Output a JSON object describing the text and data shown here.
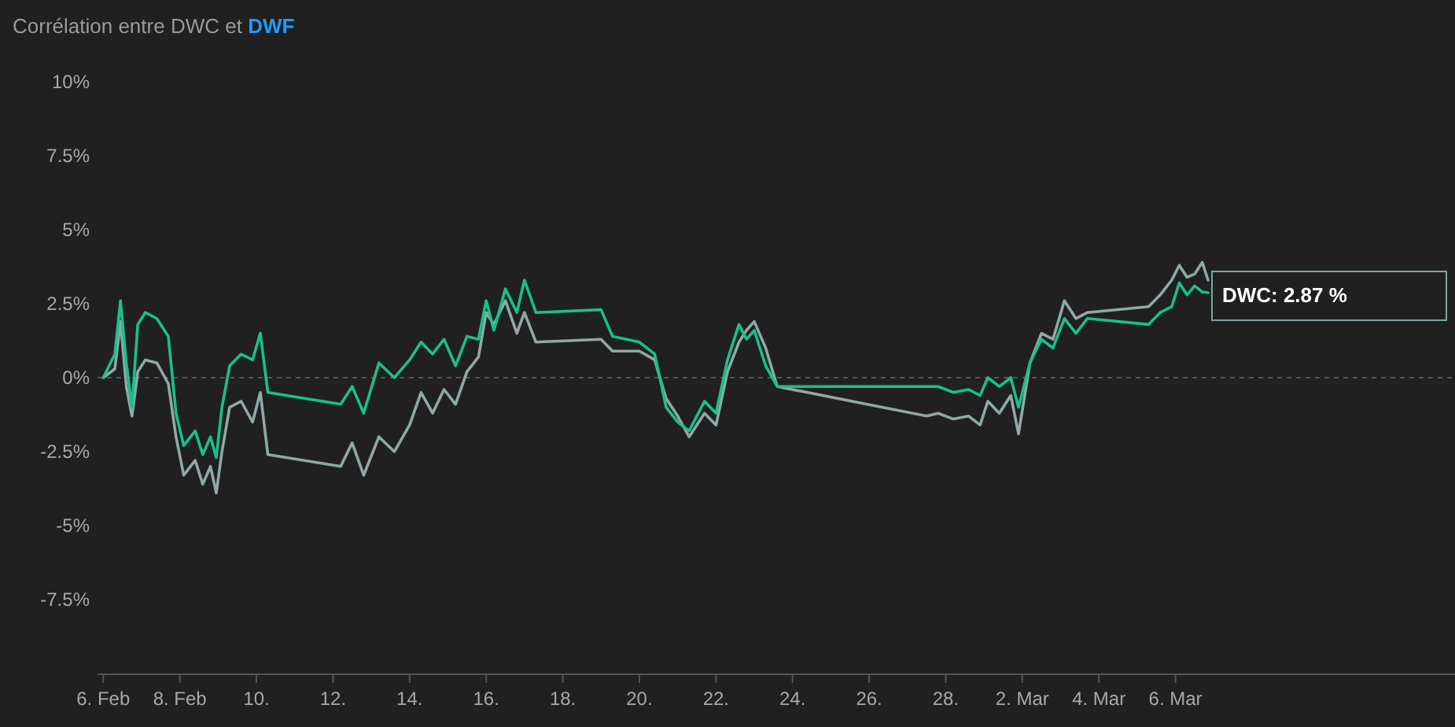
{
  "title": {
    "prefix": "Corrélation entre",
    "joiner": "et"
  },
  "tooltip": {
    "text": "DWC: 2.87 %"
  },
  "chart_data": {
    "type": "line",
    "xlim": [
      5.85,
      41.3
    ],
    "ylim": [
      -10,
      10
    ],
    "yticks": [
      {
        "value": 10,
        "label": "10%"
      },
      {
        "value": 7.5,
        "label": "7.5%"
      },
      {
        "value": 5,
        "label": "5%"
      },
      {
        "value": 2.5,
        "label": "2.5%"
      },
      {
        "value": 0,
        "label": "0%"
      },
      {
        "value": -2.5,
        "label": "-2.5%"
      },
      {
        "value": -5,
        "label": "-5%"
      },
      {
        "value": -7.5,
        "label": "-7.5%"
      }
    ],
    "xticks": [
      {
        "value": 6,
        "label": "6. Feb"
      },
      {
        "value": 8,
        "label": "8. Feb"
      },
      {
        "value": 10,
        "label": "10."
      },
      {
        "value": 12,
        "label": "12."
      },
      {
        "value": 14,
        "label": "14."
      },
      {
        "value": 16,
        "label": "16."
      },
      {
        "value": 18,
        "label": "18."
      },
      {
        "value": 20,
        "label": "20."
      },
      {
        "value": 22,
        "label": "22."
      },
      {
        "value": 24,
        "label": "24."
      },
      {
        "value": 26,
        "label": "26."
      },
      {
        "value": 28,
        "label": "28."
      },
      {
        "value": 30,
        "label": "2. Mar"
      },
      {
        "value": 32,
        "label": "4. Mar"
      },
      {
        "value": 34,
        "label": "6. Mar"
      }
    ],
    "x": [
      6,
      6.3,
      6.45,
      6.6,
      6.75,
      6.9,
      7.1,
      7.4,
      7.7,
      7.9,
      8.1,
      8.4,
      8.6,
      8.8,
      8.95,
      9.1,
      9.3,
      9.6,
      9.9,
      10.1,
      10.3,
      12.2,
      12.5,
      12.8,
      13.2,
      13.6,
      14.0,
      14.3,
      14.6,
      14.9,
      15.2,
      15.5,
      15.8,
      16.0,
      16.2,
      16.5,
      16.8,
      17.0,
      17.3,
      19.0,
      19.3,
      20.0,
      20.4,
      20.7,
      21.0,
      21.3,
      21.7,
      22.0,
      22.3,
      22.6,
      22.8,
      23.0,
      23.3,
      23.6,
      27.5,
      27.8,
      28.2,
      28.6,
      28.9,
      29.1,
      29.4,
      29.7,
      29.9,
      30.2,
      30.5,
      30.8,
      31.1,
      31.4,
      31.7,
      33.3,
      33.6,
      33.9,
      34.1,
      34.3,
      34.5,
      34.7,
      34.85
    ],
    "series": [
      {
        "name": "DWC",
        "color": "#19c08a",
        "values": [
          0,
          0.8,
          2.6,
          0.5,
          -1.0,
          1.8,
          2.2,
          2.0,
          1.4,
          -1.2,
          -2.3,
          -1.8,
          -2.6,
          -2.0,
          -2.7,
          -1.0,
          0.4,
          0.8,
          0.6,
          1.5,
          -0.5,
          -0.9,
          -0.3,
          -1.2,
          0.5,
          0.0,
          0.6,
          1.2,
          0.8,
          1.3,
          0.4,
          1.4,
          1.3,
          2.6,
          1.6,
          3.0,
          2.2,
          3.3,
          2.2,
          2.3,
          1.4,
          1.2,
          0.8,
          -1.0,
          -1.5,
          -1.8,
          -0.8,
          -1.2,
          0.6,
          1.8,
          1.3,
          1.6,
          0.4,
          -0.3,
          -0.3,
          -0.3,
          -0.5,
          -0.4,
          -0.6,
          0.0,
          -0.3,
          0.0,
          -1.0,
          0.5,
          1.3,
          1.0,
          2.0,
          1.5,
          2.0,
          1.8,
          2.2,
          2.4,
          3.2,
          2.8,
          3.1,
          2.9,
          2.87
        ]
      },
      {
        "name": "DWF",
        "color": "#8fa8a8",
        "values": [
          0,
          0.3,
          1.9,
          -0.3,
          -1.3,
          0.2,
          0.6,
          0.5,
          -0.2,
          -2.0,
          -3.3,
          -2.8,
          -3.6,
          -3.0,
          -3.9,
          -2.5,
          -1.0,
          -0.8,
          -1.5,
          -0.5,
          -2.6,
          -3.0,
          -2.2,
          -3.3,
          -2.0,
          -2.5,
          -1.6,
          -0.5,
          -1.2,
          -0.4,
          -0.9,
          0.2,
          0.7,
          2.2,
          1.8,
          2.6,
          1.5,
          2.2,
          1.2,
          1.3,
          0.9,
          0.9,
          0.6,
          -0.7,
          -1.3,
          -2.0,
          -1.2,
          -1.6,
          0.2,
          1.2,
          1.6,
          1.9,
          1.0,
          -0.3,
          -1.3,
          -1.2,
          -1.4,
          -1.3,
          -1.6,
          -0.8,
          -1.2,
          -0.6,
          -1.9,
          0.5,
          1.5,
          1.3,
          2.6,
          2.0,
          2.2,
          2.4,
          2.8,
          3.3,
          3.8,
          3.4,
          3.5,
          3.9,
          3.3
        ]
      }
    ]
  }
}
